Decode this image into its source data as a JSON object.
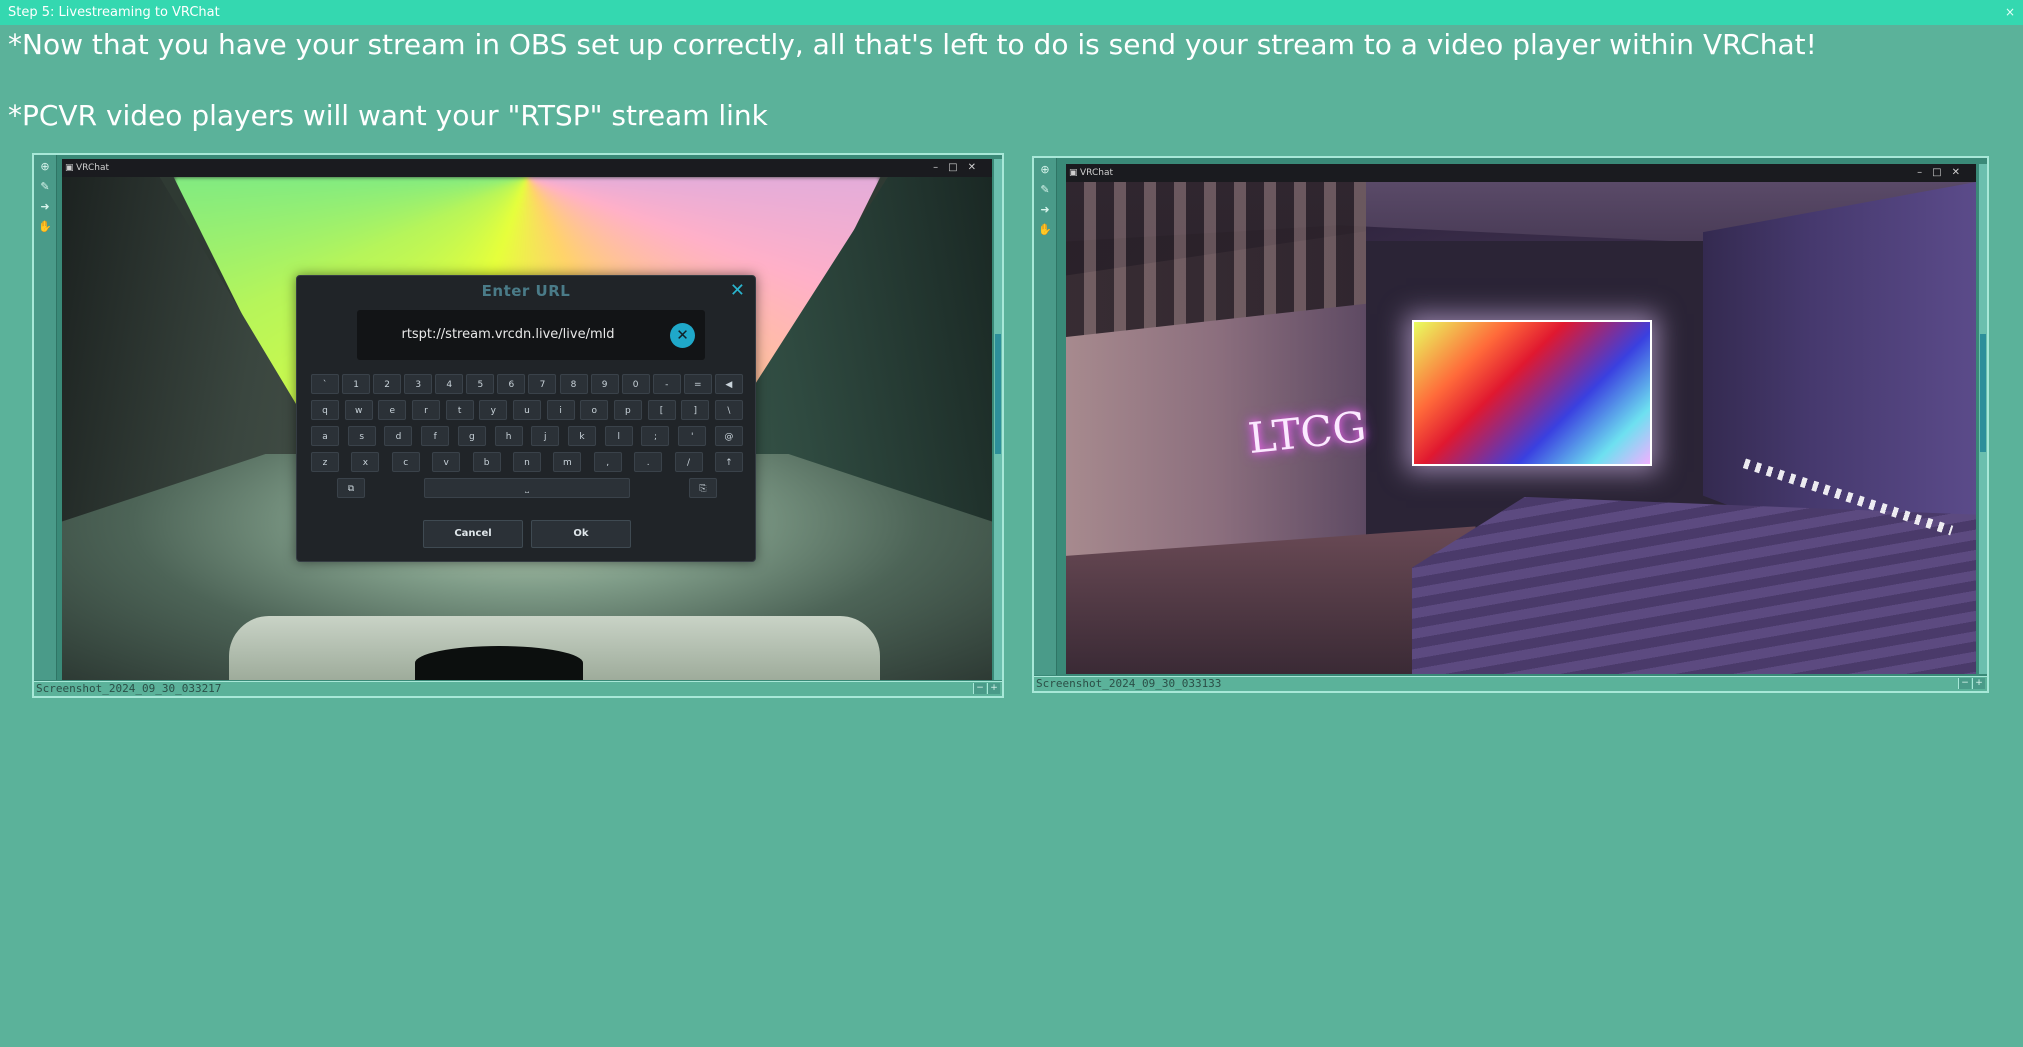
{
  "window": {
    "title": "Step 5: Livestreaming to VRChat",
    "close_glyph": "×"
  },
  "instructions": {
    "line1": "*Now that you have your stream in OBS set up correctly, all that's left to do is send your stream to a video player within VRChat!",
    "line2": "*PCVR video players will want your \"RTSP\" stream link"
  },
  "viewers": [
    {
      "filename": "Screenshot_2024_09_30_033217",
      "app_title": "VRChat",
      "dialog": {
        "title": "Enter URL",
        "url": "rtspt://stream.vrcdn.live/live/mld",
        "cancel_label": "Cancel",
        "ok_label": "Ok",
        "keyboard_rows": [
          [
            "`",
            "1",
            "2",
            "3",
            "4",
            "5",
            "6",
            "7",
            "8",
            "9",
            "0",
            "-",
            "=",
            "◀"
          ],
          [
            "q",
            "w",
            "e",
            "r",
            "t",
            "y",
            "u",
            "i",
            "o",
            "p",
            "[",
            "]",
            "\\"
          ],
          [
            "a",
            "s",
            "d",
            "f",
            "g",
            "h",
            "j",
            "k",
            "l",
            ";",
            "'",
            "@"
          ],
          [
            "z",
            "x",
            "c",
            "v",
            "b",
            "n",
            "m",
            ",",
            ".",
            "/",
            "↑"
          ]
        ],
        "space_glyph": "⎵"
      }
    },
    {
      "filename": "Screenshot_2024_09_30_033133",
      "app_title": "VRChat",
      "neon_sign": "LTCG"
    }
  ],
  "colors": {
    "background": "#5bb29a",
    "titlebar": "#34d8b0",
    "accent": "#1fa8c9"
  }
}
